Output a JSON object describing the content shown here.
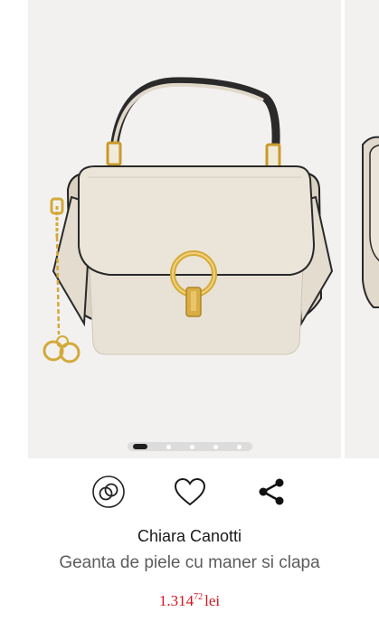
{
  "gallery": {
    "image_alt": "Chiara Canotti beige leather handbag with gold ring clasp",
    "slide_count": 5,
    "active_slide": 1
  },
  "actions": {
    "compare_icon": "compare-rings-icon",
    "wishlist_icon": "heart-icon",
    "share_icon": "share-icon"
  },
  "product": {
    "brand": "Chiara Canotti",
    "title": "Geanta de piele cu maner si clapa",
    "price_int": "1.314",
    "price_dec": "72",
    "currency": "lei"
  },
  "colors": {
    "price": "#d2141e",
    "bag": "#e6dfd3",
    "gold": "#d4a93a"
  }
}
